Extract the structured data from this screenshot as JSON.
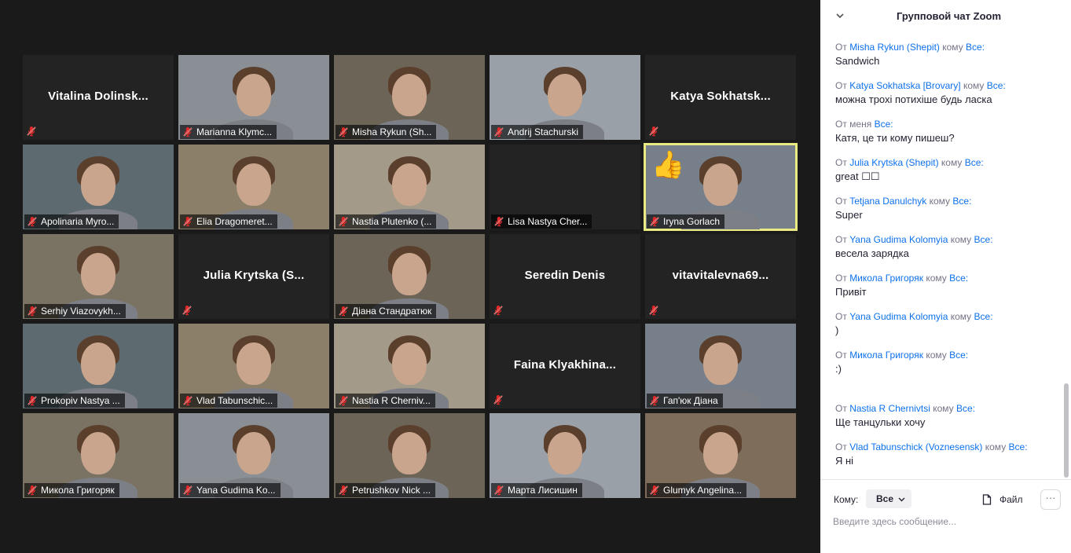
{
  "chat": {
    "title": "Групповой чат Zoom",
    "from_word": "От",
    "to_word": "кому",
    "messages": [
      {
        "sender": "Misha Rykun (Shepit)",
        "to": "Все:",
        "text": "Sandwich"
      },
      {
        "sender": "Katya Sokhatska [Brovary]",
        "to": "Все:",
        "text": "можна трохі потихіше будь ласка"
      },
      {
        "sender_prefix": "От меня",
        "sender": "",
        "to": "Все:",
        "text": "Катя, це ти кому пишеш?"
      },
      {
        "sender": "Julia Krytska (Shepit)",
        "to": "Все:",
        "text": "great ☐☐"
      },
      {
        "sender": "Tetjana Danulchyk",
        "to": "Все:",
        "text": "Super"
      },
      {
        "sender": "Yana Gudima Kolomyia",
        "to": "Все:",
        "text": "весела зарядка"
      },
      {
        "sender": "Микола Григоряк",
        "to": "Все:",
        "text": "Привіт"
      },
      {
        "sender": "Yana Gudima Kolomyia",
        "to": "Все:",
        "text": ")"
      },
      {
        "sender": "Микола Григоряк",
        "to": "Все:",
        "text": ":)"
      },
      {
        "sender": "Nastia R Chernivtsi",
        "to": "Все:",
        "text": "Ще танцульки хочу"
      },
      {
        "sender": "Vlad Tabunschick (Voznesensk)",
        "to": "Все:",
        "text": "Я ні"
      }
    ],
    "composer": {
      "to_label": "Кому:",
      "to_value": "Все",
      "file_label": "Файл",
      "more_label": "···",
      "placeholder": "Введите здесь сообщение..."
    }
  },
  "gallery": {
    "reaction": "👍",
    "participants": [
      {
        "display": "name",
        "name": "Vitalina  Dolinsk...",
        "tag": ""
      },
      {
        "display": "video",
        "name": "",
        "tag": "Marianna Klymc..."
      },
      {
        "display": "video",
        "name": "",
        "tag": "Misha Rykun (Sh..."
      },
      {
        "display": "video",
        "name": "",
        "tag": "Andrij Stachurski"
      },
      {
        "display": "name",
        "name": "Katya  Sokhatsk...",
        "tag": ""
      },
      {
        "display": "video",
        "name": "",
        "tag": "Apolinaria Myro..."
      },
      {
        "display": "video",
        "name": "",
        "tag": "Elia Dragomeret..."
      },
      {
        "display": "video",
        "name": "",
        "tag": "Nastia Plutenko (..."
      },
      {
        "display": "blank",
        "name": "",
        "tag": "Lisa Nastya Cher..."
      },
      {
        "display": "video",
        "name": "",
        "tag": "Iryna Gorlach",
        "active": true
      },
      {
        "display": "video",
        "name": "",
        "tag": "Serhiy Viazovykh..."
      },
      {
        "display": "name",
        "name": "Julia  Krytska  (S...",
        "tag": ""
      },
      {
        "display": "video",
        "name": "",
        "tag": "Діана Стандратюк"
      },
      {
        "display": "name",
        "name": "Seredin Denis",
        "tag": ""
      },
      {
        "display": "name",
        "name": "vitavitalevna69...",
        "tag": ""
      },
      {
        "display": "video",
        "name": "",
        "tag": "Prokopiv Nastya ..."
      },
      {
        "display": "video",
        "name": "",
        "tag": "Vlad Tabunschic..."
      },
      {
        "display": "video",
        "name": "",
        "tag": "Nastia R Cherniv..."
      },
      {
        "display": "name",
        "name": "Faina  Klyakhina...",
        "tag": ""
      },
      {
        "display": "video",
        "name": "",
        "tag": "Гап'юк Діана"
      },
      {
        "display": "video",
        "name": "",
        "tag": "Микола Григоряк"
      },
      {
        "display": "video",
        "name": "",
        "tag": "Yana Gudima Ko..."
      },
      {
        "display": "video",
        "name": "",
        "tag": "Petrushkov Nick ..."
      },
      {
        "display": "video",
        "name": "",
        "tag": "Марта Лисишин"
      },
      {
        "display": "video",
        "name": "",
        "tag": "Glumyk Angelina..."
      }
    ]
  },
  "icons": {
    "muted": "microphone-muted-icon",
    "collapse": "chevron-down-icon",
    "file": "file-icon"
  },
  "colors": {
    "link": "#0e71eb",
    "mute": "#e02828",
    "active_border": "#e9ea82"
  }
}
